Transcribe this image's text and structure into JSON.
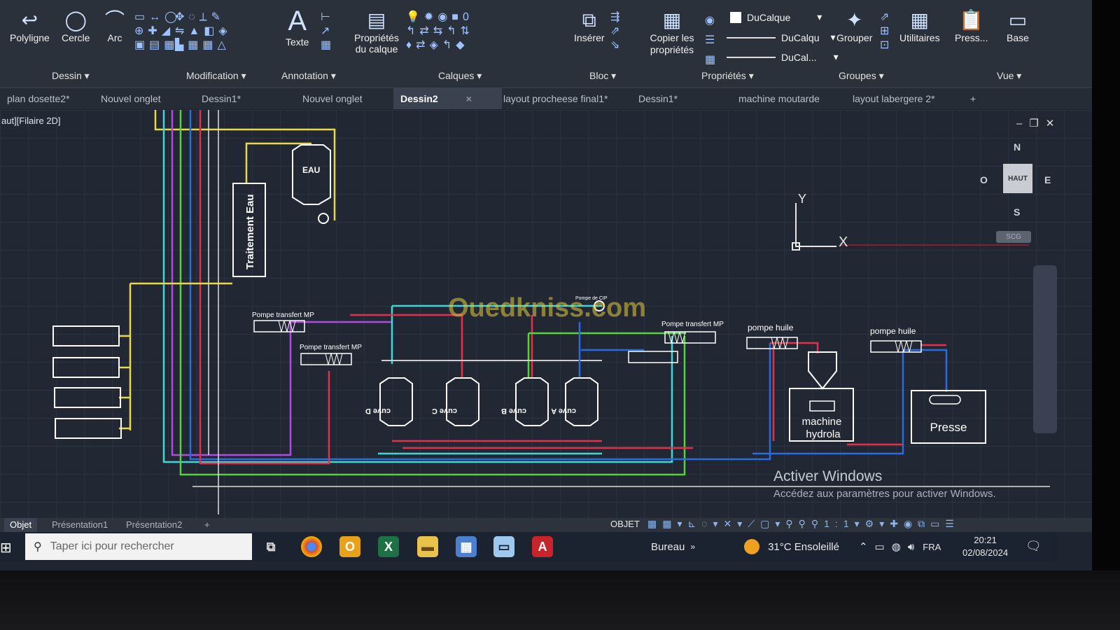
{
  "ribbon": {
    "draw_tools": [
      {
        "label": "Polyligne",
        "icon": "polyline-icon"
      },
      {
        "label": "Cercle",
        "icon": "circle-icon"
      },
      {
        "label": "Arc",
        "icon": "arc-icon"
      }
    ],
    "panels": {
      "dessin": "Dessin",
      "modification": "Modification",
      "annotation": "Annotation",
      "calques": "Calques",
      "bloc": "Bloc",
      "proprietes": "Propriétés",
      "groupes": "Groupes",
      "vue": "Vue"
    },
    "texte_label": "Texte",
    "layer_props_label": "Propriétés du calque",
    "layer_number": "0",
    "inserer_label": "Insérer",
    "copier_label": "Copier les propriétés",
    "prop_color": "DuCalque",
    "prop_linetype": "DuCalqu",
    "prop_lineweight": "DuCal...",
    "grouper_label": "Grouper",
    "utilitaires_label": "Utilitaires",
    "presse_label": "Press...",
    "base_label": "Base"
  },
  "tabs": [
    {
      "label": "plan dosette2*"
    },
    {
      "label": "Nouvel onglet"
    },
    {
      "label": "Dessin1*"
    },
    {
      "label": "Nouvel onglet"
    },
    {
      "label": "Dessin2",
      "active": true
    },
    {
      "label": "layout procheese final1*"
    },
    {
      "label": "Dessin1*"
    },
    {
      "label": "machine moutarde"
    },
    {
      "label": "layout labergere 2*"
    }
  ],
  "viewport": {
    "label": "aut][Filaire 2D]",
    "viewcube": {
      "north": "N",
      "south": "S",
      "east": "E",
      "west": "O",
      "face": "HAUT",
      "wcs": "SCG"
    },
    "ucs": {
      "x": "X",
      "y": "Y"
    }
  },
  "drawing": {
    "eau": "EAU",
    "traitement_eau": "Traitement Eau",
    "pompe_transfert": "Pompe transfert MP",
    "pompe_huile": "pompe huile",
    "cuves": [
      "cuve D",
      "cuve C",
      "cuve B",
      "cuve A"
    ],
    "machine_line1": "machine",
    "machine_line2": "hydrola",
    "presse": "Presse",
    "pompe_cip": "Pompe de CIP"
  },
  "watermark": "Ouedkniss.com",
  "activate_windows": {
    "title": "Activer Windows",
    "subtitle": "Accédez aux paramètres pour activer Windows."
  },
  "statusbar": {
    "layout_tabs": [
      "Objet",
      "Présentation1",
      "Présentation2"
    ],
    "objet_button": "OBJET",
    "scale": "1:1"
  },
  "taskbar": {
    "search_placeholder": "Taper ici pour rechercher",
    "bureau": "Bureau",
    "weather": "31°C  Ensoleillé",
    "language": "FRA",
    "time": "20:21",
    "date": "02/08/2024"
  }
}
